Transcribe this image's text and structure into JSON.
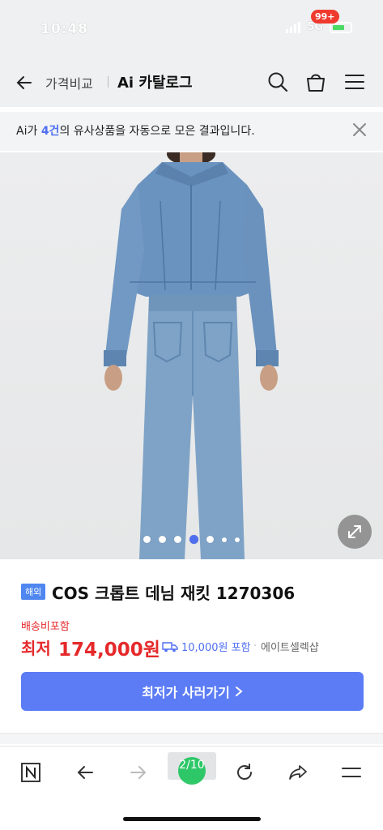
{
  "status_bar": {
    "time": "10:48",
    "network": "5G",
    "battery_color": "#4cd964"
  },
  "header": {
    "breadcrumb": "가격비교",
    "title": "Ai 카탈로그",
    "cart_badge": "99+"
  },
  "ai_banner": {
    "prefix": "Ai가 ",
    "count": "4건",
    "suffix": "의 유사상품을 자동으로 모은 결과입니다."
  },
  "gallery": {
    "current_index": 4,
    "dot_count": 7
  },
  "product": {
    "badge": "해외",
    "name": "COS 크롭트 데님 재킷 1270306",
    "shipping_label": "배송비포함",
    "price_label": "최저",
    "price": "174,000원",
    "delivery_fee": "10,000원 포함",
    "seller": "에이트셀렉샵",
    "buy_button": "최저가 사러가기"
  },
  "toolbar": {
    "tab_counter": "2/10"
  },
  "colors": {
    "accent": "#5b7cf5",
    "price_red": "#e5292b",
    "badge_blue": "#4f86f0"
  }
}
